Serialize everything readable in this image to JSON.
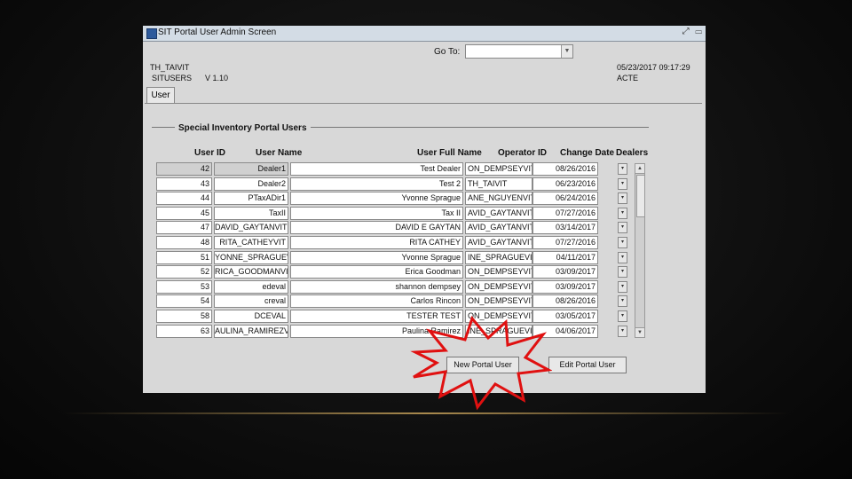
{
  "window": {
    "title": "SIT Portal User Admin Screen",
    "controls": "⤢ ▭"
  },
  "goto": {
    "label": "Go To:",
    "value": ""
  },
  "header": {
    "user": "TH_TAIVIT",
    "db": "SITUSERS",
    "version": "V 1.10",
    "datetime": "05/23/2017 09:17:29",
    "status": "ACTE"
  },
  "tab": {
    "label": "User"
  },
  "section": {
    "title": "Special Inventory Portal Users"
  },
  "columns": [
    "User ID",
    "User Name",
    "User Full Name",
    "Operator ID",
    "Change Date",
    "Dealers"
  ],
  "rows": [
    {
      "id": "42",
      "name": "Dealer1",
      "full": "Test Dealer",
      "op": "ON_DEMPSEYVIT",
      "date": "08/26/2016"
    },
    {
      "id": "43",
      "name": "Dealer2",
      "full": "Test 2",
      "op": "TH_TAIVIT",
      "date": "06/23/2016"
    },
    {
      "id": "44",
      "name": "PTaxADir1",
      "full": "Yvonne Sprague",
      "op": "ANE_NGUYENVIT",
      "date": "06/24/2016"
    },
    {
      "id": "45",
      "name": "TaxII",
      "full": "Tax II",
      "op": "AVID_GAYTANVIT",
      "date": "07/27/2016"
    },
    {
      "id": "47",
      "name": "DAVID_GAYTANVIT",
      "full": "DAVID E GAYTAN",
      "op": "AVID_GAYTANVIT",
      "date": "03/14/2017"
    },
    {
      "id": "48",
      "name": "RITA_CATHEYVIT",
      "full": "RITA CATHEY",
      "op": "AVID_GAYTANVIT",
      "date": "07/27/2016"
    },
    {
      "id": "51",
      "name": "YONNE_SPRAGUEVIT",
      "full": "Yvonne Sprague",
      "op": "INE_SPRAGUEVIT",
      "date": "04/11/2017"
    },
    {
      "id": "52",
      "name": "RICA_GOODMANVIT",
      "full": "Erica Goodman",
      "op": "ON_DEMPSEYVIT",
      "date": "03/09/2017"
    },
    {
      "id": "53",
      "name": "edeval",
      "full": "shannon dempsey",
      "op": "ON_DEMPSEYVIT",
      "date": "03/09/2017"
    },
    {
      "id": "54",
      "name": "creval",
      "full": "Carlos Rincon",
      "op": "ON_DEMPSEYVIT",
      "date": "08/26/2016"
    },
    {
      "id": "58",
      "name": "DCEVAL",
      "full": "TESTER TEST",
      "op": "ON_DEMPSEYVIT",
      "date": "03/05/2017"
    },
    {
      "id": "63",
      "name": "AULINA_RAMIREZVIT",
      "full": "Paulina Ramirez",
      "op": "INE_SPRAGUEVIT",
      "date": "04/06/2017"
    }
  ],
  "buttons": {
    "new_portal_user": "New Portal User",
    "edit_portal_user": "Edit Portal User"
  },
  "colors": {
    "starburst_stroke": "#e01010",
    "starburst_fill": "#ffffff",
    "title_bar": "#d3dce5"
  }
}
